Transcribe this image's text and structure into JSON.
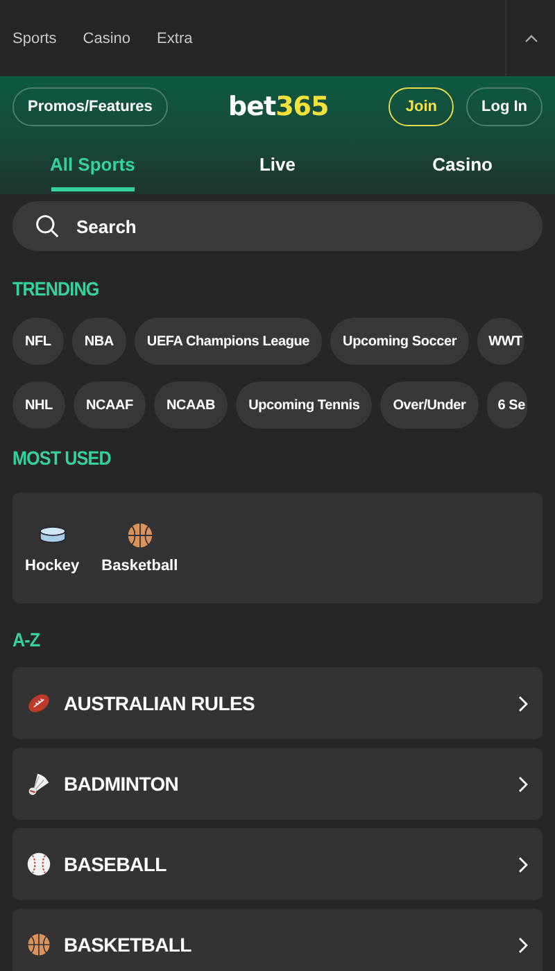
{
  "top_nav": {
    "items": [
      {
        "label": "Sports",
        "selected": false
      },
      {
        "label": "Casino",
        "selected": false
      },
      {
        "label": "Extra",
        "selected": false
      }
    ]
  },
  "header": {
    "promos_button": "Promos/Features",
    "logo": {
      "part_1": "bet",
      "part_2": "365"
    },
    "join_button": "Join",
    "login_button": "Log In"
  },
  "tabs": [
    {
      "label": "All Sports",
      "selected": true
    },
    {
      "label": "Live",
      "selected": false
    },
    {
      "label": "Casino",
      "selected": false
    }
  ],
  "search": {
    "placeholder": "Search"
  },
  "trending": {
    "title": "TRENDING",
    "chip_lines": [
      {
        "chips": [
          "NFL",
          "NBA",
          "UEFA Champions League",
          "Upcoming Soccer",
          "WWT"
        ]
      },
      {
        "chips": [
          "NHL",
          "NCAAF",
          "NCAAB",
          "Upcoming Tennis",
          "Over/Under",
          "6 Se"
        ]
      }
    ]
  },
  "most_used": {
    "title": "MOST USED",
    "items": [
      {
        "label": "Hockey",
        "kind": "hockey"
      },
      {
        "label": "Basketball",
        "kind": "basketball"
      }
    ]
  },
  "a_z": {
    "title": "A-Z",
    "items": [
      {
        "label": "AUSTRALIAN RULES",
        "kind": "football"
      },
      {
        "label": "BADMINTON",
        "kind": "shuttlecock"
      },
      {
        "label": "BASEBALL",
        "kind": "baseball"
      },
      {
        "label": "BASKETBALL",
        "kind": "basketball"
      }
    ]
  }
}
